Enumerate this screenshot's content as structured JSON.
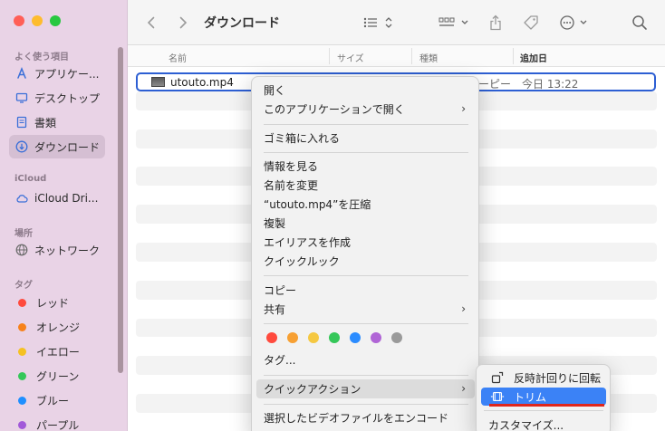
{
  "window": {
    "title": "ダウンロード"
  },
  "sidebar": {
    "sections": {
      "favorites": "よく使う項目",
      "icloud": "iCloud",
      "locations": "場所",
      "tags": "タグ"
    },
    "favorites": [
      {
        "label": "アプリケー...",
        "icon": "applications-icon"
      },
      {
        "label": "デスクトップ",
        "icon": "desktop-icon"
      },
      {
        "label": "書類",
        "icon": "documents-icon"
      },
      {
        "label": "ダウンロード",
        "icon": "downloads-icon",
        "selected": true
      }
    ],
    "icloud": [
      {
        "label": "iCloud Dri...",
        "icon": "cloud-icon"
      }
    ],
    "locations": [
      {
        "label": "ネットワーク",
        "icon": "network-icon"
      }
    ],
    "tags": [
      {
        "label": "レッド",
        "color": "#ff4a3d"
      },
      {
        "label": "オレンジ",
        "color": "#f7821b"
      },
      {
        "label": "イエロー",
        "color": "#f5c122"
      },
      {
        "label": "グリーン",
        "color": "#35c759"
      },
      {
        "label": "ブルー",
        "color": "#1f8fff"
      },
      {
        "label": "パープル",
        "color": "#a259d9"
      }
    ]
  },
  "columns": {
    "name": "名前",
    "size": "サイズ",
    "kind": "種類",
    "date_added": "追加日"
  },
  "file": {
    "name": "utouto.mp4",
    "kind": "ーピー",
    "date_added": "今日 13:22"
  },
  "context_menu": {
    "items": [
      {
        "label": "開く"
      },
      {
        "label": "このアプリケーションで開く",
        "submenu": true
      },
      {
        "label": "ゴミ箱に入れる"
      },
      {
        "label": "情報を見る"
      },
      {
        "label": "名前を変更"
      },
      {
        "label": "“utouto.mp4”を圧縮"
      },
      {
        "label": "複製"
      },
      {
        "label": "エイリアスを作成"
      },
      {
        "label": "クイックルック"
      },
      {
        "label": "コピー"
      },
      {
        "label": "共有",
        "submenu": true
      },
      {
        "label": "タグ..."
      },
      {
        "label": "クイックアクション",
        "submenu": true,
        "highlighted": true
      },
      {
        "label": "選択したビデオファイルをエンコード"
      }
    ],
    "tag_colors": [
      "#ff4a3d",
      "#f7a033",
      "#f5c842",
      "#35c759",
      "#2b8cff",
      "#b065d6",
      "#9a9a9a"
    ]
  },
  "quick_actions_submenu": {
    "items": [
      {
        "label": "反時計回りに回転",
        "icon": "rotate-left-icon"
      },
      {
        "label": "トリム",
        "icon": "trim-icon",
        "active": true
      },
      {
        "label": "カスタマイズ..."
      }
    ]
  },
  "accent_color": "#3b82f6"
}
